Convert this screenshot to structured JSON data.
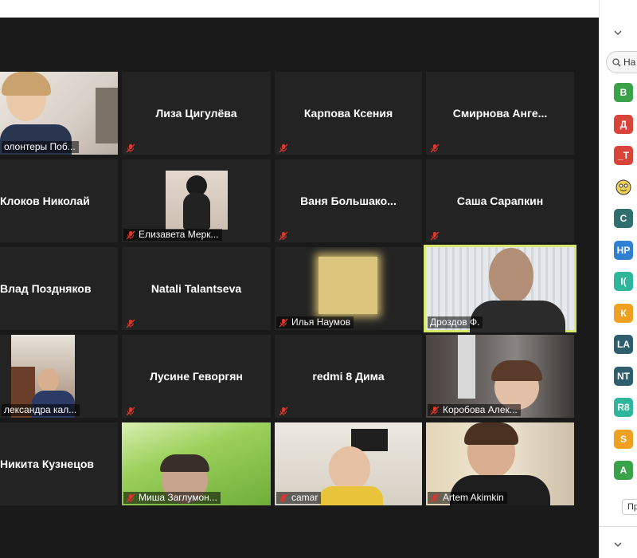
{
  "participants": [
    {
      "name": "олонтеры Поб..."
    },
    {
      "name": "Лиза Цигулёва"
    },
    {
      "name": "Карпова Ксения"
    },
    {
      "name": "Смирнова  Анге..."
    },
    {
      "name": "Клоков Николай"
    },
    {
      "name": "Елизавета Мерк..."
    },
    {
      "name": "Ваня  Большако..."
    },
    {
      "name": "Саша Сарапкин"
    },
    {
      "name": "Влад Поздняков"
    },
    {
      "name": "Natali Talantseva"
    },
    {
      "name": "Илья Наумов"
    },
    {
      "name": "Дроздов Ф."
    },
    {
      "name": "лександра кал..."
    },
    {
      "name": "Лусине Геворгян"
    },
    {
      "name": "redmi 8 Дима"
    },
    {
      "name": "Коробова Алек..."
    },
    {
      "name": "Никита Кузнецов"
    },
    {
      "name": "Миша Заглумон..."
    },
    {
      "name": "camar"
    },
    {
      "name": "Artem Akimkin"
    }
  ],
  "sidebar": {
    "search_text": "На",
    "more_label": "Пр",
    "avatars": [
      {
        "initials": "В",
        "color": "#3aa34a"
      },
      {
        "initials": "Д",
        "color": "#d9443a"
      },
      {
        "initials": "_Т",
        "color": "#d9443a"
      },
      {
        "initials": "",
        "color": "#f1d05a"
      },
      {
        "initials": "С",
        "color": "#2f6f6f"
      },
      {
        "initials": "HP",
        "color": "#2f7fd2"
      },
      {
        "initials": "I(",
        "color": "#2fb59a"
      },
      {
        "initials": "К",
        "color": "#f0a020"
      },
      {
        "initials": "LA",
        "color": "#2f5f6f"
      },
      {
        "initials": "NT",
        "color": "#2f5f6f"
      },
      {
        "initials": "R8",
        "color": "#2fb59a"
      },
      {
        "initials": "S",
        "color": "#f0a020"
      },
      {
        "initials": "А",
        "color": "#3aa34a"
      }
    ]
  },
  "colors": {
    "active_speaker": "#d7e86c",
    "tile_bg": "#232323",
    "muted_mic": "#e0362c"
  }
}
